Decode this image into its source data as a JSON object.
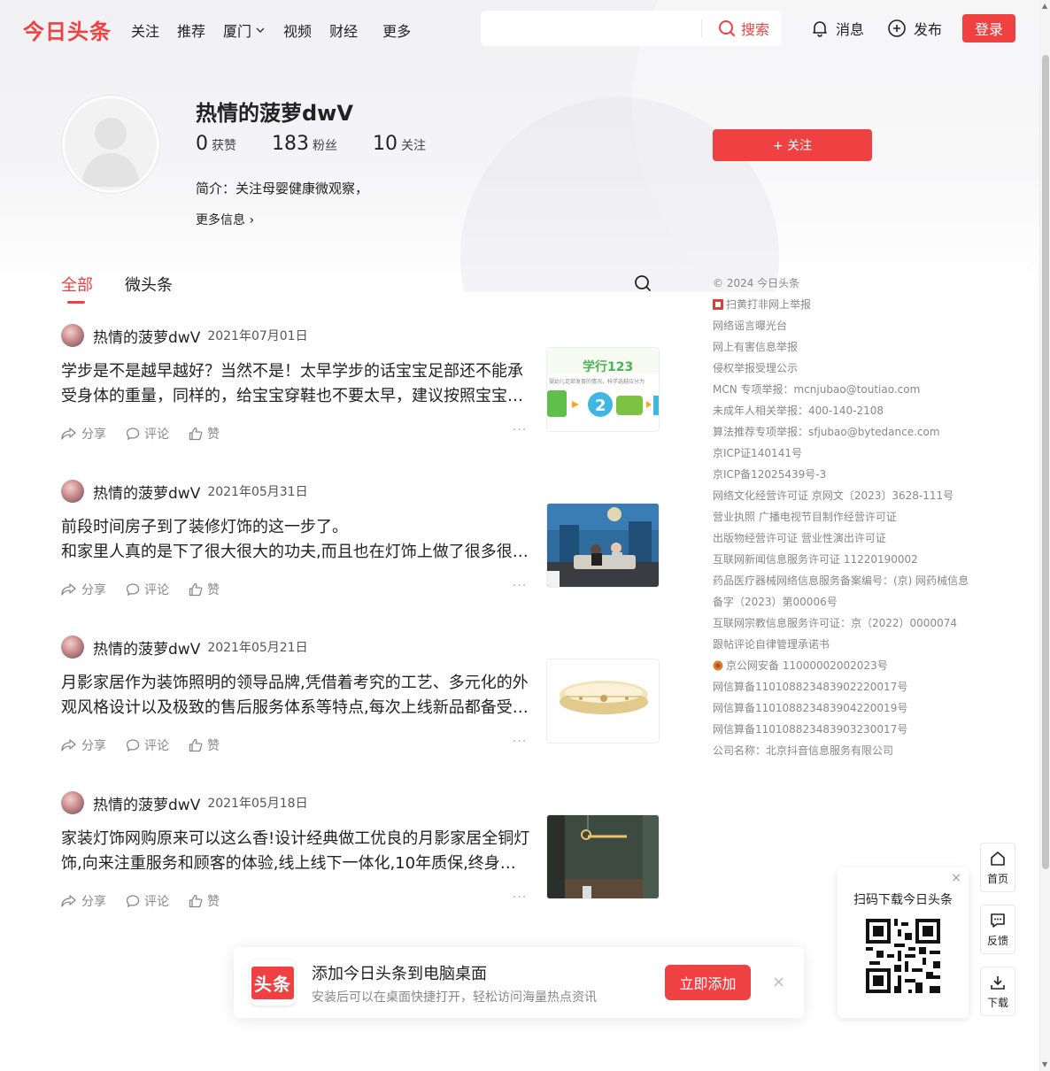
{
  "header": {
    "logo": "今日头条",
    "nav": [
      "关注",
      "推荐",
      "厦门",
      "视频",
      "财经",
      "更多"
    ],
    "search_placeholder": "",
    "search_label": "搜索",
    "messages_label": "消息",
    "publish_label": "发布",
    "login_label": "登录"
  },
  "profile": {
    "name": "热情的菠萝dwV",
    "likes_num": "0",
    "likes_label": "获赞",
    "fans_num": "183",
    "fans_label": "粉丝",
    "follow_num": "10",
    "follow_label": "关注",
    "bio": "简介：关注母婴健康微观察，",
    "more_info": "更多信息 ›",
    "follow_button": "+ 关注"
  },
  "tabs": {
    "all": "全部",
    "micro": "微头条"
  },
  "feed": [
    {
      "author": "热情的菠萝dwV",
      "date": "2021年07月01日",
      "line1": "学步是不是越早越好？当然不是！太早学步的话宝宝足部还不能承",
      "line2": "受身体的重量，同样的，给宝宝穿鞋也不要太早，建议按照宝宝…",
      "share": "分享",
      "comment": "评论",
      "like": "赞"
    },
    {
      "author": "热情的菠萝dwV",
      "date": "2021年05月31日",
      "line1": "前段时间房子到了装修灯饰的这一步了。",
      "line2": "和家里人真的是下了很大很大的功夫,而且也在灯饰上做了很多很…",
      "share": "分享",
      "comment": "评论",
      "like": "赞"
    },
    {
      "author": "热情的菠萝dwV",
      "date": "2021年05月21日",
      "line1": "月影家居作为装饰照明的领导品牌,凭借着考究的工艺、多元化的外",
      "line2": "观风格设计以及极致的售后服务体系等特点,每次上线新品都备受…",
      "share": "分享",
      "comment": "评论",
      "like": "赞"
    },
    {
      "author": "热情的菠萝dwV",
      "date": "2021年05月18日",
      "line1": "家装灯饰网购原来可以这么香!设计经典做工优良的月影家居全铜灯",
      "line2": "饰,向来注重服务和顾客的体验,线上线下一体化,10年质保,终身售…",
      "share": "分享",
      "comment": "评论",
      "like": "赞"
    }
  ],
  "thumb1_texts": {
    "brand": "学行123",
    "caption": "婴幼儿足部发育的情况，科学选鞋应分为",
    "step": "2"
  },
  "sidebar": [
    "© 2024 今日头条",
    "扫黄打非网上举报",
    "网络谣言曝光台",
    "网上有害信息举报",
    "侵权举报受理公示",
    "MCN 专项举报：mcnjubao@toutiao.com",
    "未成年人相关举报：400-140-2108",
    "算法推荐专项举报：sfjubao@bytedance.com",
    "京ICP证140141号",
    "京ICP备12025439号-3",
    "网络文化经营许可证 京网文〔2023〕3628-111号",
    "营业执照 广播电视节目制作经营许可证",
    "出版物经营许可证 营业性演出许可证",
    "互联网新闻信息服务许可证 11220190002",
    "药品医疗器械网络信息服务备案编号：(京) 网药械信息",
    "备字（2023）第00006号",
    "互联网宗教信息服务许可证：京（2022）0000074",
    "跟帖评论自律管理承诺书",
    "京公网安备 11000002002023号",
    "网信算备110108823483902220017号",
    "网信算备110108823483904220019号",
    "网信算备110108823483903230017号",
    "公司名称：北京抖音信息服务有限公司"
  ],
  "side_buttons": {
    "home": "首页",
    "feedback": "反馈",
    "download": "下载"
  },
  "qr": {
    "title": "扫码下载今日头条",
    "close": "×"
  },
  "banner": {
    "logo_text": "头条",
    "title": "添加今日头条到电脑桌面",
    "subtitle": "安装后可以在桌面快捷打开，轻松访问海量热点资讯",
    "button": "立即添加",
    "close": "×"
  },
  "colors": {
    "brand": "#f04142"
  }
}
